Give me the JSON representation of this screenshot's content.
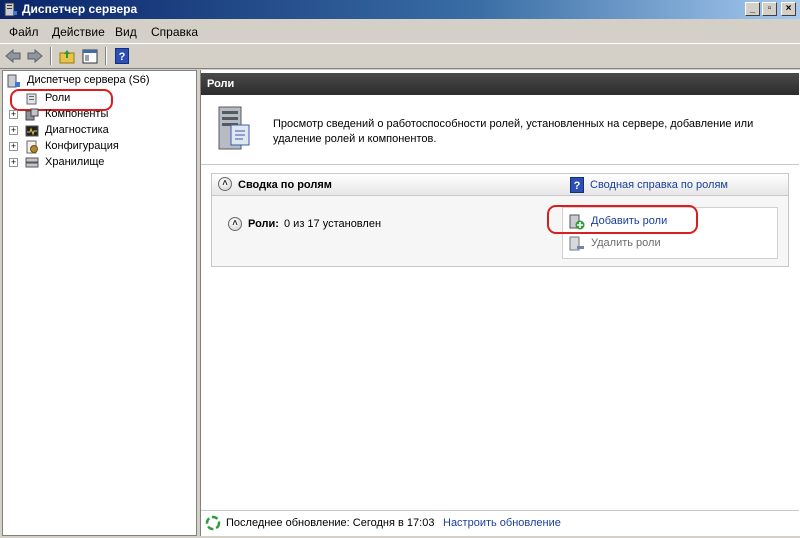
{
  "window": {
    "title": "Диспетчер сервера"
  },
  "menu": {
    "items": [
      "Файл",
      "Действие",
      "Вид",
      "Справка"
    ]
  },
  "tree": {
    "root": "Диспетчер сервера (S6)",
    "items": [
      {
        "label": "Роли"
      },
      {
        "label": "Компоненты"
      },
      {
        "label": "Диагностика"
      },
      {
        "label": "Конфигурация"
      },
      {
        "label": "Хранилище"
      }
    ]
  },
  "main": {
    "header": "Роли",
    "description": "Просмотр сведений о работоспособности ролей, установленных на сервере, добавление или удаление ролей и компонентов.",
    "summary": {
      "title": "Сводка по ролям",
      "help_link": "Сводная справка по ролям",
      "roles_label": "Роли:",
      "roles_value": "0 из 17 установлен",
      "add_roles": "Добавить роли",
      "remove_roles": "Удалить роли"
    },
    "status": {
      "last_update": "Последнее обновление: Сегодня в 17:03",
      "configure_link": "Настроить обновление"
    }
  },
  "colors": {
    "highlight_ring": "#d81e1e",
    "link": "#1a3e9a"
  },
  "icons": [
    "server-manager-icon",
    "back-icon",
    "forward-icon",
    "up-folder-icon",
    "console-tree-icon",
    "help-icon",
    "roles-icon",
    "features-icon",
    "diagnostics-icon",
    "configuration-icon",
    "storage-icon",
    "server-icon",
    "add-roles-icon",
    "remove-roles-icon",
    "refresh-icon"
  ]
}
